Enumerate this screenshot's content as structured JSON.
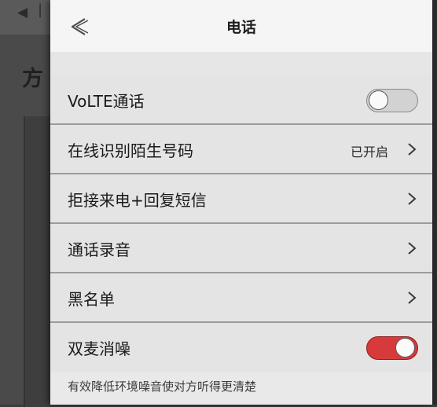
{
  "background": {
    "back_glyph": "◀",
    "snippet": "|",
    "heading": "方"
  },
  "header": {
    "title": "电话",
    "back_icon": "chevron-left-icon"
  },
  "rows": [
    {
      "label": "VoLTE通话",
      "type": "toggle",
      "on": false
    },
    {
      "label": "在线识别陌生号码",
      "type": "link",
      "value": "已开启"
    },
    {
      "label": "拒接来电+回复短信",
      "type": "link"
    },
    {
      "label": "通话录音",
      "type": "link"
    },
    {
      "label": "黑名单",
      "type": "link"
    },
    {
      "label": "双麦消噪",
      "type": "toggle",
      "on": true
    }
  ],
  "footnote": "有效降低环境噪音使对方听得更清楚",
  "colors": {
    "toggle_on": "#d73a3a",
    "toggle_off": "#d2d2d2"
  }
}
